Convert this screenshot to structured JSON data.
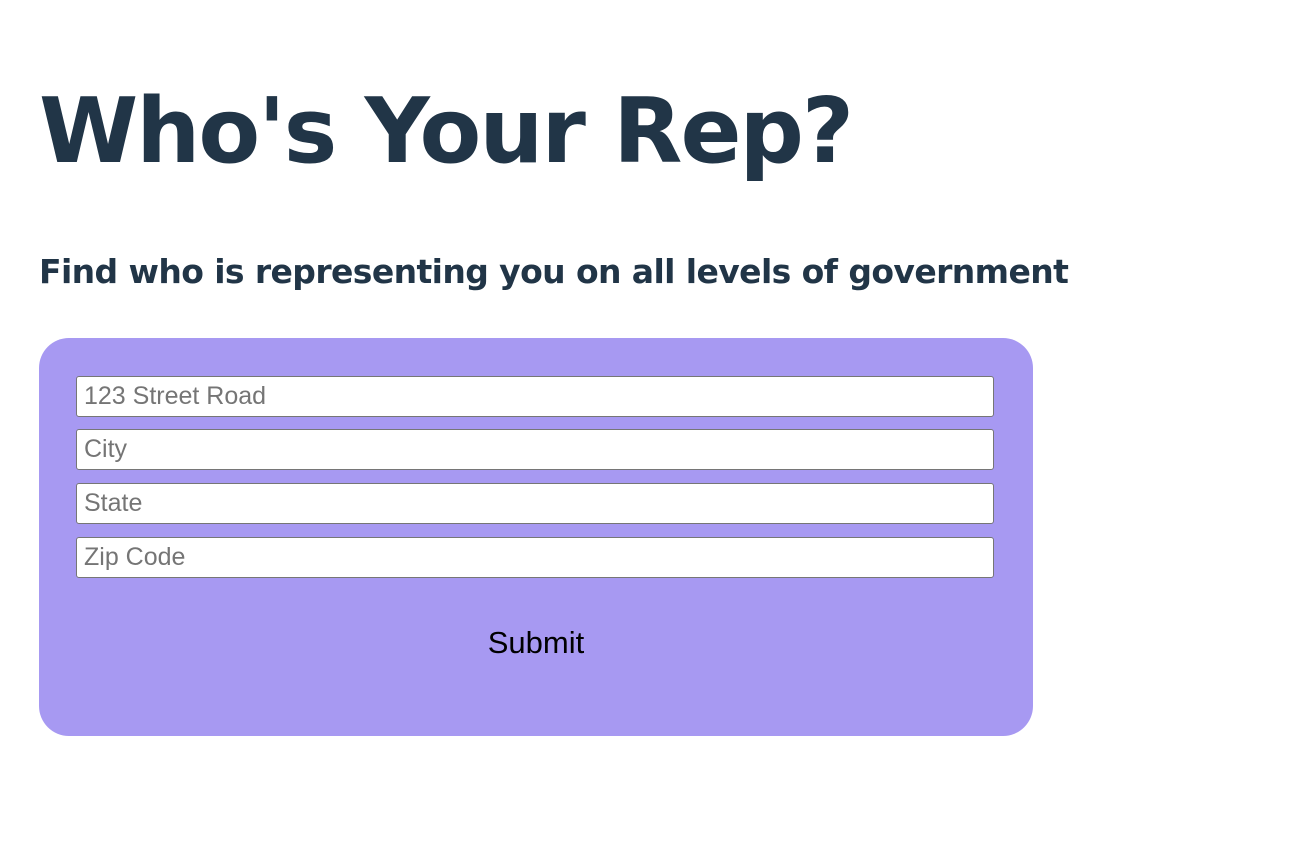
{
  "header": {
    "title": "Who's Your Rep?",
    "subtitle": "Find who is representing you on all levels of government"
  },
  "form": {
    "background_color": "#a799f2",
    "fields": [
      {
        "placeholder": "123 Street Road",
        "value": ""
      },
      {
        "placeholder": "City",
        "value": ""
      },
      {
        "placeholder": "State",
        "value": ""
      },
      {
        "placeholder": "Zip Code",
        "value": ""
      }
    ],
    "submit_label": "Submit"
  },
  "colors": {
    "heading_text": "#213547",
    "page_background": "#ffffff"
  }
}
